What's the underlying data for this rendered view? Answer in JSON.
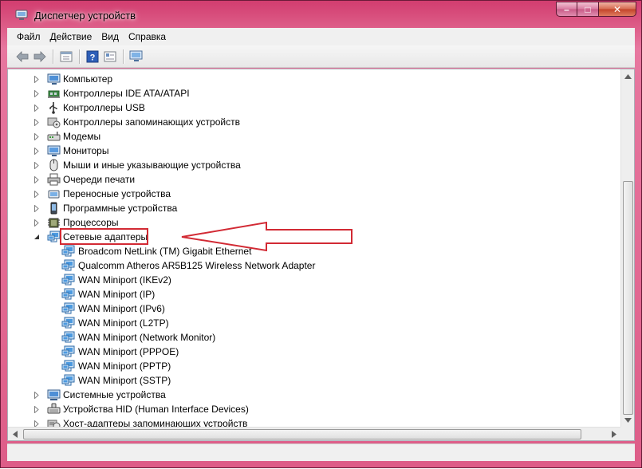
{
  "window": {
    "title": "Диспетчер устройств"
  },
  "window_controls": {
    "minimize": "–",
    "maximize": "□",
    "close": "✕"
  },
  "menu": [
    {
      "label": "Файл"
    },
    {
      "label": "Действие"
    },
    {
      "label": "Вид"
    },
    {
      "label": "Справка"
    }
  ],
  "toolbar": [
    {
      "icon": "back-icon"
    },
    {
      "icon": "forward-icon"
    },
    {
      "icon": "properties-icon"
    },
    {
      "icon": "help-icon"
    },
    {
      "icon": "view-icon"
    },
    {
      "icon": "scan-hardware-icon"
    }
  ],
  "tree": {
    "categories_before": [
      {
        "label": "Компьютер",
        "icon": "computer-icon"
      },
      {
        "label": "Контроллеры IDE ATA/ATAPI",
        "icon": "ide-controller-icon"
      },
      {
        "label": "Контроллеры USB",
        "icon": "usb-icon"
      },
      {
        "label": "Контроллеры запоминающих устройств",
        "icon": "storage-controller-icon"
      },
      {
        "label": "Модемы",
        "icon": "modem-icon"
      },
      {
        "label": "Мониторы",
        "icon": "monitor-icon"
      },
      {
        "label": "Мыши и иные указывающие устройства",
        "icon": "mouse-icon"
      },
      {
        "label": "Очереди печати",
        "icon": "printer-icon"
      },
      {
        "label": "Переносные устройства",
        "icon": "portable-device-icon"
      },
      {
        "label": "Программные устройства",
        "icon": "software-device-icon"
      },
      {
        "label": "Процессоры",
        "icon": "processor-icon"
      }
    ],
    "expanded": {
      "label": "Сетевые адаптеры",
      "icon": "network-adapter-icon",
      "children": [
        "Broadcom NetLink (TM) Gigabit Ethernet",
        "Qualcomm Atheros AR5B125 Wireless Network Adapter",
        "WAN Miniport (IKEv2)",
        "WAN Miniport (IP)",
        "WAN Miniport (IPv6)",
        "WAN Miniport (L2TP)",
        "WAN Miniport (Network Monitor)",
        "WAN Miniport (PPPOE)",
        "WAN Miniport (PPTP)",
        "WAN Miniport (SSTP)"
      ]
    },
    "categories_after": [
      {
        "label": "Системные устройства",
        "icon": "system-device-icon"
      },
      {
        "label": "Устройства HID (Human Interface Devices)",
        "icon": "hid-icon"
      },
      {
        "label": "Хост-адаптеры запоминающих устройств",
        "icon": "storage-host-adapter-icon"
      }
    ]
  },
  "colors": {
    "title_bar": "#d23d6f",
    "annotation": "#d22a34"
  }
}
